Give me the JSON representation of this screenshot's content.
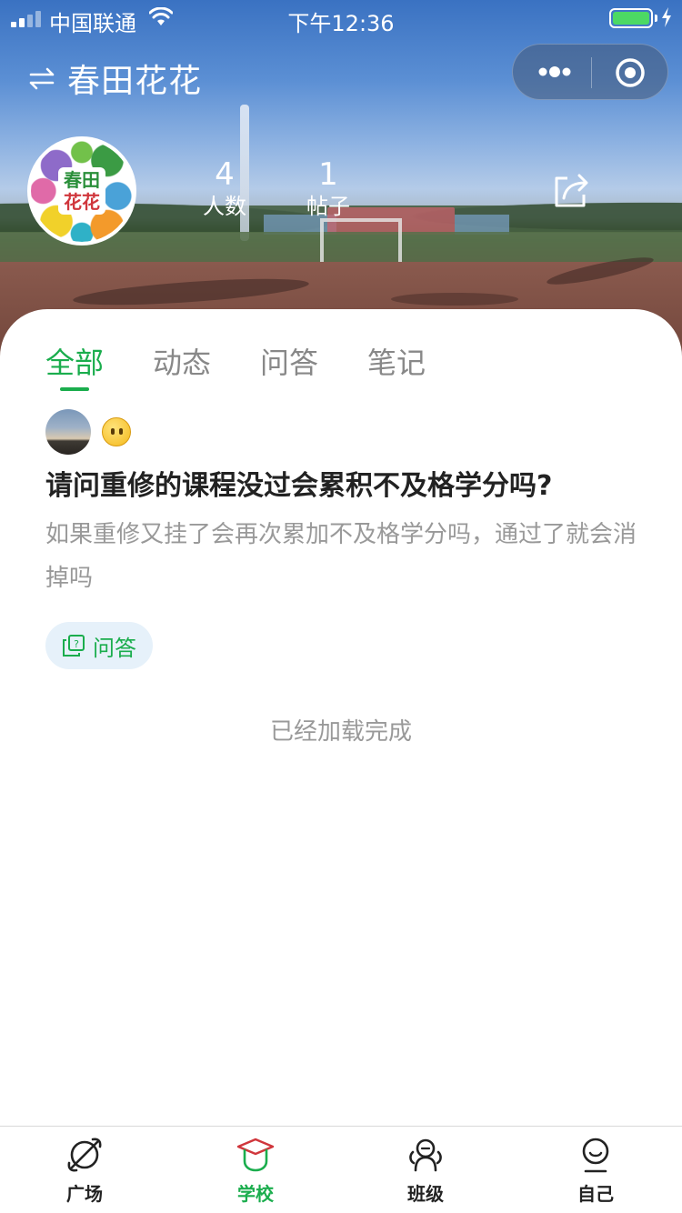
{
  "status_bar": {
    "carrier": "中国联通",
    "time": "下午12:36"
  },
  "nav": {
    "title": "春田花花",
    "switch_icon": "switch-arrows-icon",
    "capsule_more_icon": "more-dots-icon",
    "capsule_close_icon": "target-circle-icon"
  },
  "group": {
    "avatar_text_line1": "春田",
    "avatar_text_line2": "花花",
    "members_count": "4",
    "members_label": "人数",
    "posts_count": "1",
    "posts_label": "帖子",
    "share_icon": "share-icon"
  },
  "tabs": [
    {
      "label": "全部",
      "active": true
    },
    {
      "label": "动态",
      "active": false
    },
    {
      "label": "问答",
      "active": false
    },
    {
      "label": "笔记",
      "active": false
    }
  ],
  "post": {
    "title": "请问重修的课程没过会累积不及格学分吗?",
    "excerpt": "如果重修又挂了会再次累加不及格学分吗，通过了就会消掉吗",
    "tag_label": "问答"
  },
  "footer_text": "已经加载完成",
  "tabbar": [
    {
      "label": "广场",
      "icon": "planet-icon",
      "active": false
    },
    {
      "label": "学校",
      "icon": "graduation-cap-icon",
      "active": true
    },
    {
      "label": "班级",
      "icon": "class-group-icon",
      "active": false
    },
    {
      "label": "自己",
      "icon": "profile-smile-icon",
      "active": false
    }
  ],
  "colors": {
    "accent": "#1aad4d",
    "muted_text": "#999999",
    "tag_bg": "#e6f1fa"
  }
}
